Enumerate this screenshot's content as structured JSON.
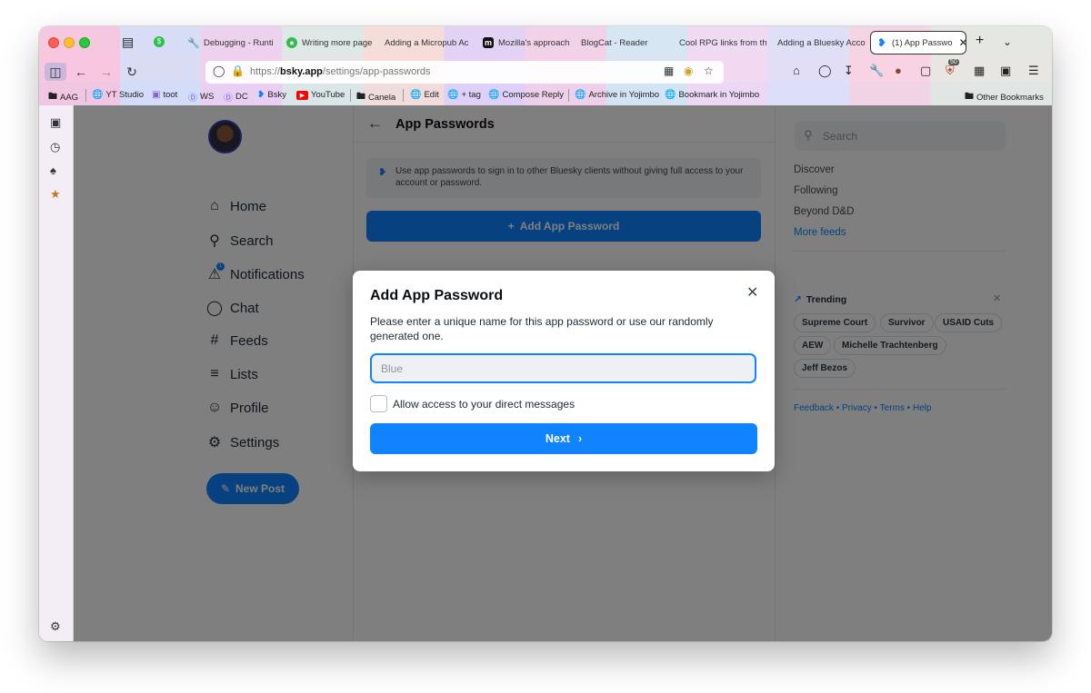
{
  "browser": {
    "tabs": [
      {
        "title": "Debugging - Runti",
        "icon": "wrench-icon"
      },
      {
        "title": "Writing more page",
        "icon": "gamepad-icon"
      },
      {
        "title": "Adding a Micropub Ac",
        "icon": ""
      },
      {
        "title": "Mozilla's approach",
        "icon": "m-logo-icon"
      },
      {
        "title": "BlogCat - Reader",
        "icon": ""
      },
      {
        "title": "Cool RPG links from th",
        "icon": ""
      },
      {
        "title": "Adding a Bluesky Acco",
        "icon": ""
      },
      {
        "title": "(1) App Passwo",
        "icon": "bluesky-butterfly-icon",
        "active": true
      }
    ],
    "url_prefix": "https://",
    "url_domain": "bsky.app",
    "url_path": "/settings/app-passwords",
    "toolbar_badge": "50",
    "bookmarks": [
      {
        "label": "AAG",
        "icon": "folder-icon"
      },
      {
        "label": "YT Studio",
        "icon": "globe-icon"
      },
      {
        "label": "toot",
        "icon": "toot-icon"
      },
      {
        "label": "WS",
        "icon": "mastodon-icon"
      },
      {
        "label": "DC",
        "icon": "mastodon-icon"
      },
      {
        "label": "Bsky",
        "icon": "bluesky-butterfly-icon"
      },
      {
        "label": "YouTube",
        "icon": "youtube-icon"
      },
      {
        "label": "Canela",
        "icon": "folder-icon"
      },
      {
        "label": "Edit",
        "icon": "globe-icon"
      },
      {
        "label": "+ tag",
        "icon": "globe-icon"
      },
      {
        "label": "Compose Reply",
        "icon": "globe-icon"
      },
      {
        "label": "Archive in Yojimbo",
        "icon": "globe-icon"
      },
      {
        "label": "Bookmark in Yojimbo",
        "icon": "globe-icon"
      },
      {
        "label": "Other Bookmarks",
        "icon": "folder-icon"
      }
    ]
  },
  "left_nav": {
    "items": [
      {
        "label": "Home",
        "icon": "home-icon"
      },
      {
        "label": "Search",
        "icon": "search-icon"
      },
      {
        "label": "Notifications",
        "icon": "bell-icon",
        "badge": "1"
      },
      {
        "label": "Chat",
        "icon": "chat-icon"
      },
      {
        "label": "Feeds",
        "icon": "hash-icon"
      },
      {
        "label": "Lists",
        "icon": "list-icon"
      },
      {
        "label": "Profile",
        "icon": "profile-icon"
      },
      {
        "label": "Settings",
        "icon": "gear-icon"
      }
    ],
    "new_post": "New Post"
  },
  "center": {
    "title": "App Passwords",
    "info": "Use app passwords to sign in to other Bluesky clients without giving full access to your account or password.",
    "add_button": "Add App Password"
  },
  "right": {
    "search_placeholder": "Search",
    "feeds": [
      "Discover",
      "Following",
      "Beyond D&D"
    ],
    "more_feeds": "More feeds",
    "trending_title": "Trending",
    "trending": [
      "Supreme Court",
      "Survivor",
      "USAID Cuts",
      "AEW",
      "Michelle Trachtenberg",
      "Jeff Bezos"
    ],
    "footer": [
      "Feedback",
      "Privacy",
      "Terms",
      "Help"
    ],
    "footer_sep": " • "
  },
  "modal": {
    "title": "Add App Password",
    "description": "Please enter a unique name for this app password or use our randomly generated one.",
    "input_placeholder": "Blue",
    "input_value": "",
    "checkbox_label": "Allow access to your direct messages",
    "checkbox_checked": false,
    "next_button": "Next"
  },
  "colors": {
    "brand_blue": "#1083fe",
    "overlay": "rgba(0,0,0,0.5)"
  }
}
